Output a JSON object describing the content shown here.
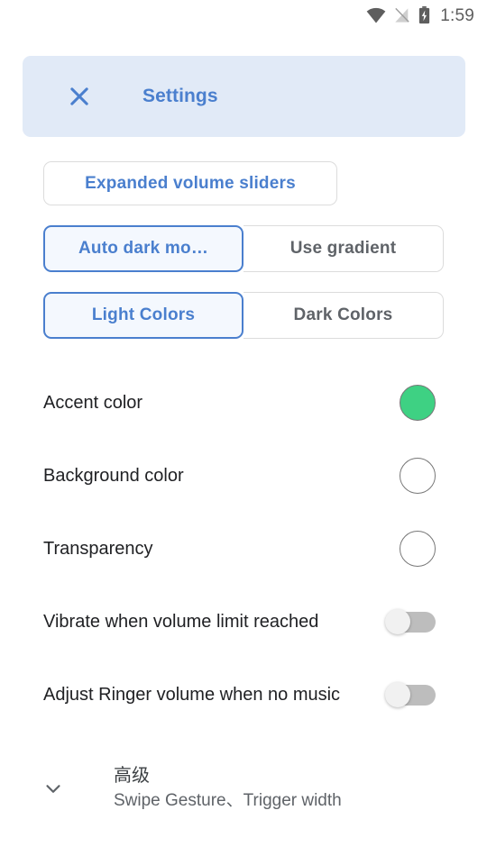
{
  "status_bar": {
    "wifi_icon": "wifi-icon",
    "signal_off_icon": "signal-disabled-icon",
    "battery_icon": "battery-charging-icon",
    "time": "1:59"
  },
  "header": {
    "close_icon": "close-icon",
    "title": "Settings",
    "background_color": "#e1eaf7",
    "accent_color": "#4a7fce"
  },
  "expanded_sliders_button": {
    "label": "Expanded volume sliders"
  },
  "segmented_controls": [
    {
      "name": "dark-mode-gradient-group",
      "options": [
        {
          "label": "Auto dark mo…",
          "selected": true
        },
        {
          "label": "Use gradient",
          "selected": false
        }
      ]
    },
    {
      "name": "color-scheme-group",
      "options": [
        {
          "label": "Light Colors",
          "selected": true
        },
        {
          "label": "Dark Colors",
          "selected": false
        }
      ]
    }
  ],
  "preferences": [
    {
      "label": "Accent color",
      "control": "swatch",
      "color": "#3ed183"
    },
    {
      "label": "Background color",
      "control": "swatch",
      "color": "#ffffff"
    },
    {
      "label": "Transparency",
      "control": "swatch",
      "color": "#ffffff"
    },
    {
      "label": "Vibrate when volume limit reached",
      "control": "switch",
      "value": "off"
    },
    {
      "label": "Adjust Ringer volume when no music",
      "control": "switch",
      "value": "off"
    }
  ],
  "advanced_section": {
    "chevron_icon": "chevron-down-icon",
    "title": "高级",
    "subtitle": "Swipe Gesture、Trigger width"
  }
}
